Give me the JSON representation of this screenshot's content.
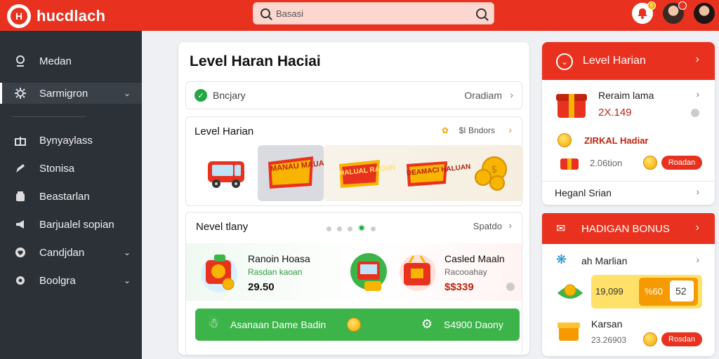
{
  "header": {
    "logo_text": "hucdlach",
    "logo_mark": "H",
    "search_placeholder": "Basasi",
    "notification_badge": "6"
  },
  "sidebar": {
    "items": [
      {
        "label": "Medan",
        "icon": "location-pin-icon"
      },
      {
        "label": "Sarmigron",
        "icon": "gear-icon",
        "chevron": true,
        "active": true
      },
      {
        "label": "Bynyaylass",
        "icon": "gift-icon"
      },
      {
        "label": "Stonisa",
        "icon": "pencil-icon"
      },
      {
        "label": "Beastarlan",
        "icon": "cup-icon"
      },
      {
        "label": "Barjualel sopian",
        "icon": "megaphone-icon"
      },
      {
        "label": "Candjdan",
        "icon": "heart-icon",
        "chevron": true
      },
      {
        "label": "Boolgra",
        "icon": "settings-icon",
        "chevron": true
      }
    ]
  },
  "main": {
    "title": "Level Haran Haciai",
    "status_row": {
      "label": "Bncjary",
      "link": "Oradiam"
    },
    "level_section": {
      "title": "Level Harian",
      "more_label": "$I Bndors",
      "tiles": [
        "bus-icon",
        "manual-sign-icon",
        "radium-sign-icon",
        "banner-icon",
        "coins-icon"
      ],
      "tile_words": [
        "MANAU MAUAI",
        "HALUAL RAOUN",
        "DEAMACI HALUAN"
      ]
    },
    "daily_section": {
      "title": "Nevel tlany",
      "link": "Spatdo",
      "page_count": 5,
      "active_page": 4,
      "offers": [
        {
          "title": "Ranoin Hoasa",
          "subtitle": "Rasdan kaoan",
          "price": "29.50"
        },
        {
          "title": "Casled Maaln",
          "subtitle": "Racooahay",
          "price": "$$339"
        }
      ],
      "banner_left": "Asanaan Dame Badin",
      "banner_right": "S4900 Daony"
    }
  },
  "right_panel_1": {
    "header": "Level Harian",
    "item1": {
      "title": "Reraim lama",
      "value": "2X.149"
    },
    "item2": {
      "title": "ZIRKAL Hadiar",
      "value": "2.06tion",
      "button": "Roadan"
    },
    "footer": "Heganl Srian"
  },
  "right_panel_2": {
    "header": "HADIGAN BONUS",
    "item1": {
      "title": "ah Marlian"
    },
    "bonus_box": {
      "left": "19,099",
      "mid": "%60",
      "right": "52"
    },
    "item3": {
      "title": "Karsan",
      "value": "23.26903",
      "button": "Rosdan"
    }
  },
  "colors": {
    "brand_red": "#e8321f",
    "sidebar_bg": "#2c3138",
    "success_green": "#3cb44a",
    "coin_gold": "#f1a600"
  }
}
